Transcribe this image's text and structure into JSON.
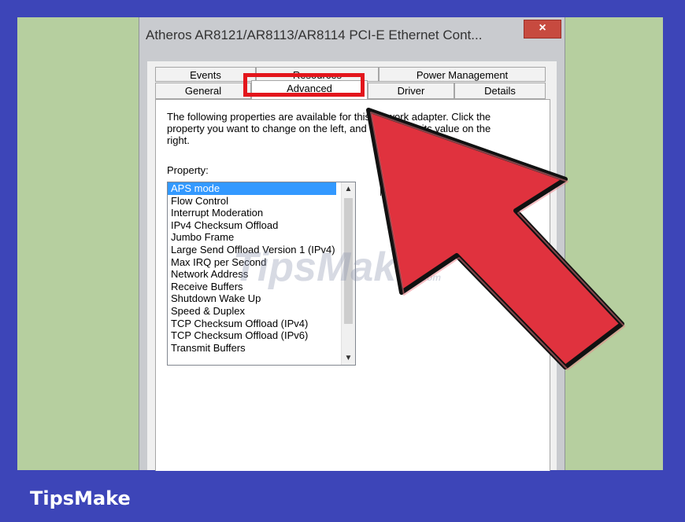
{
  "window": {
    "title": "Atheros AR8121/AR8113/AR8114 PCI-E Ethernet Cont...",
    "close_label": "×"
  },
  "tabs": {
    "row1": [
      "Events",
      "Resources",
      "Power Management"
    ],
    "row2": [
      "General",
      "Advanced",
      "Driver",
      "Details"
    ],
    "active": "Advanced"
  },
  "panel": {
    "description": "The following properties are available for this network adapter. Click the property you want to change on the left, and then select its value on the right.",
    "property_label": "Property:",
    "properties": [
      "APS mode",
      "Flow Control",
      "Interrupt Moderation",
      "IPv4 Checksum Offload",
      "Jumbo Frame",
      "Large Send Offload Version 1 (IPv4)",
      "Max IRQ per Second",
      "Network Address",
      "Receive Buffers",
      "Shutdown Wake Up",
      "Speed & Duplex",
      "TCP Checksum Offload (IPv4)",
      "TCP Checksum Offload (IPv6)",
      "Transmit Buffers"
    ],
    "selected_property": "APS mode"
  },
  "watermark": {
    "text": "TipsMake",
    "suffix": ".com"
  },
  "brand": "TipsMake",
  "colors": {
    "highlight": "#e3161c",
    "arrow": "#e0323e",
    "brand_bg": "#3d45b8",
    "frame_bg": "#b6cf9f"
  }
}
